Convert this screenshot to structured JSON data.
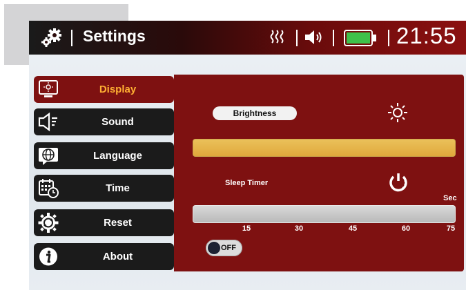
{
  "header": {
    "title": "Settings",
    "time": "21:55",
    "battery_color": "#3fc14a"
  },
  "menu": {
    "items": [
      {
        "label": "Display",
        "icon": "display-icon",
        "active": true
      },
      {
        "label": "Sound",
        "icon": "speaker-icon",
        "active": false
      },
      {
        "label": "Language",
        "icon": "globe-icon",
        "active": false
      },
      {
        "label": "Time",
        "icon": "calendar-clock-icon",
        "active": false
      },
      {
        "label": "Reset",
        "icon": "reset-gear-icon",
        "active": false
      },
      {
        "label": "About",
        "icon": "info-icon",
        "active": false
      }
    ]
  },
  "display": {
    "brightness_label": "Brightness",
    "brightness_level": 1.0,
    "sleep_timer_label": "Sleep Timer",
    "sleep_timer_unit": "Sec",
    "sleep_timer_ticks": [
      "15",
      "30",
      "45",
      "60",
      "75"
    ],
    "sleep_toggle_label": "OFF"
  },
  "colors": {
    "accent_red": "#7e1111",
    "active_text": "#ffb033",
    "brightness_bar": "#e2b04a"
  }
}
